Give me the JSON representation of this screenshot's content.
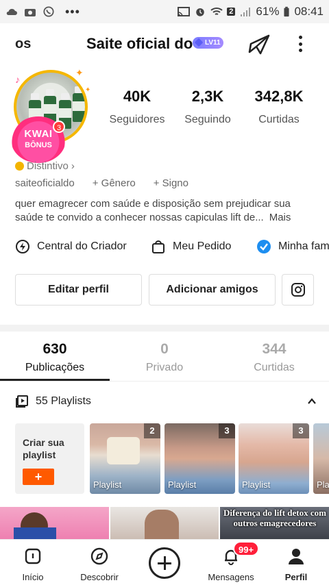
{
  "status_bar": {
    "badge": "2",
    "battery": "61%",
    "time": "08:41"
  },
  "header": {
    "left_fragment": "os",
    "title": "Saite oficial do",
    "level_badge": "LV11"
  },
  "profile": {
    "kwai_badge_line1": "KWAI",
    "kwai_badge_line2": "BÔNUS",
    "kwai_count": "3",
    "stats": [
      {
        "value": "40K",
        "label": "Seguidores"
      },
      {
        "value": "2,3K",
        "label": "Seguindo"
      },
      {
        "value": "342,8K",
        "label": "Curtidas"
      }
    ],
    "distintivo": "Distintivo",
    "username": "saiteoficialdo",
    "gender_link": "+ Gênero",
    "sign_link": "+ Signo",
    "bio_line1": "quer emagrecer com saúde e disposição sem prejudicar sua",
    "bio_line2": "saúde te convido a conhecer nossas capiculas lift de...",
    "bio_more": "Mais"
  },
  "quick_links": [
    {
      "label": "Central do Criador",
      "icon": "lightning-icon"
    },
    {
      "label": "Meu Pedido",
      "icon": "bag-icon"
    },
    {
      "label": "Minha fam",
      "icon": "verified-icon"
    }
  ],
  "buttons": {
    "edit_profile": "Editar perfil",
    "add_friends": "Adicionar amigos"
  },
  "tabs": [
    {
      "count": "630",
      "label": "Publicações",
      "active": true
    },
    {
      "count": "0",
      "label": "Privado",
      "active": false
    },
    {
      "count": "344",
      "label": "Curtidas",
      "active": false
    }
  ],
  "playlists": {
    "header": "55 Playlists",
    "create_line1": "Criar sua",
    "create_line2": "playlist",
    "create_button": "+",
    "cards": [
      {
        "label": "Playlist",
        "count": "2"
      },
      {
        "label": "Playlist",
        "count": "3"
      },
      {
        "label": "Playlist",
        "count": "3"
      },
      {
        "label": "Pla",
        "count": ""
      }
    ]
  },
  "videos": {
    "third_caption": "Diferença do lift detox com outros emagrecedores"
  },
  "bottom_nav": [
    {
      "label": "Início",
      "icon": "home-icon"
    },
    {
      "label": "Descobrir",
      "icon": "compass-icon"
    },
    {
      "label": "Mensagens",
      "icon": "bell-icon"
    },
    {
      "label": "Perfil",
      "icon": "user-icon"
    }
  ],
  "notifications_badge": "99+",
  "colors": {
    "accent": "#ff5a00",
    "badge_red": "#ff1f3a",
    "level_badge": "#7a7cff",
    "verified_blue": "#1e8ef0"
  }
}
